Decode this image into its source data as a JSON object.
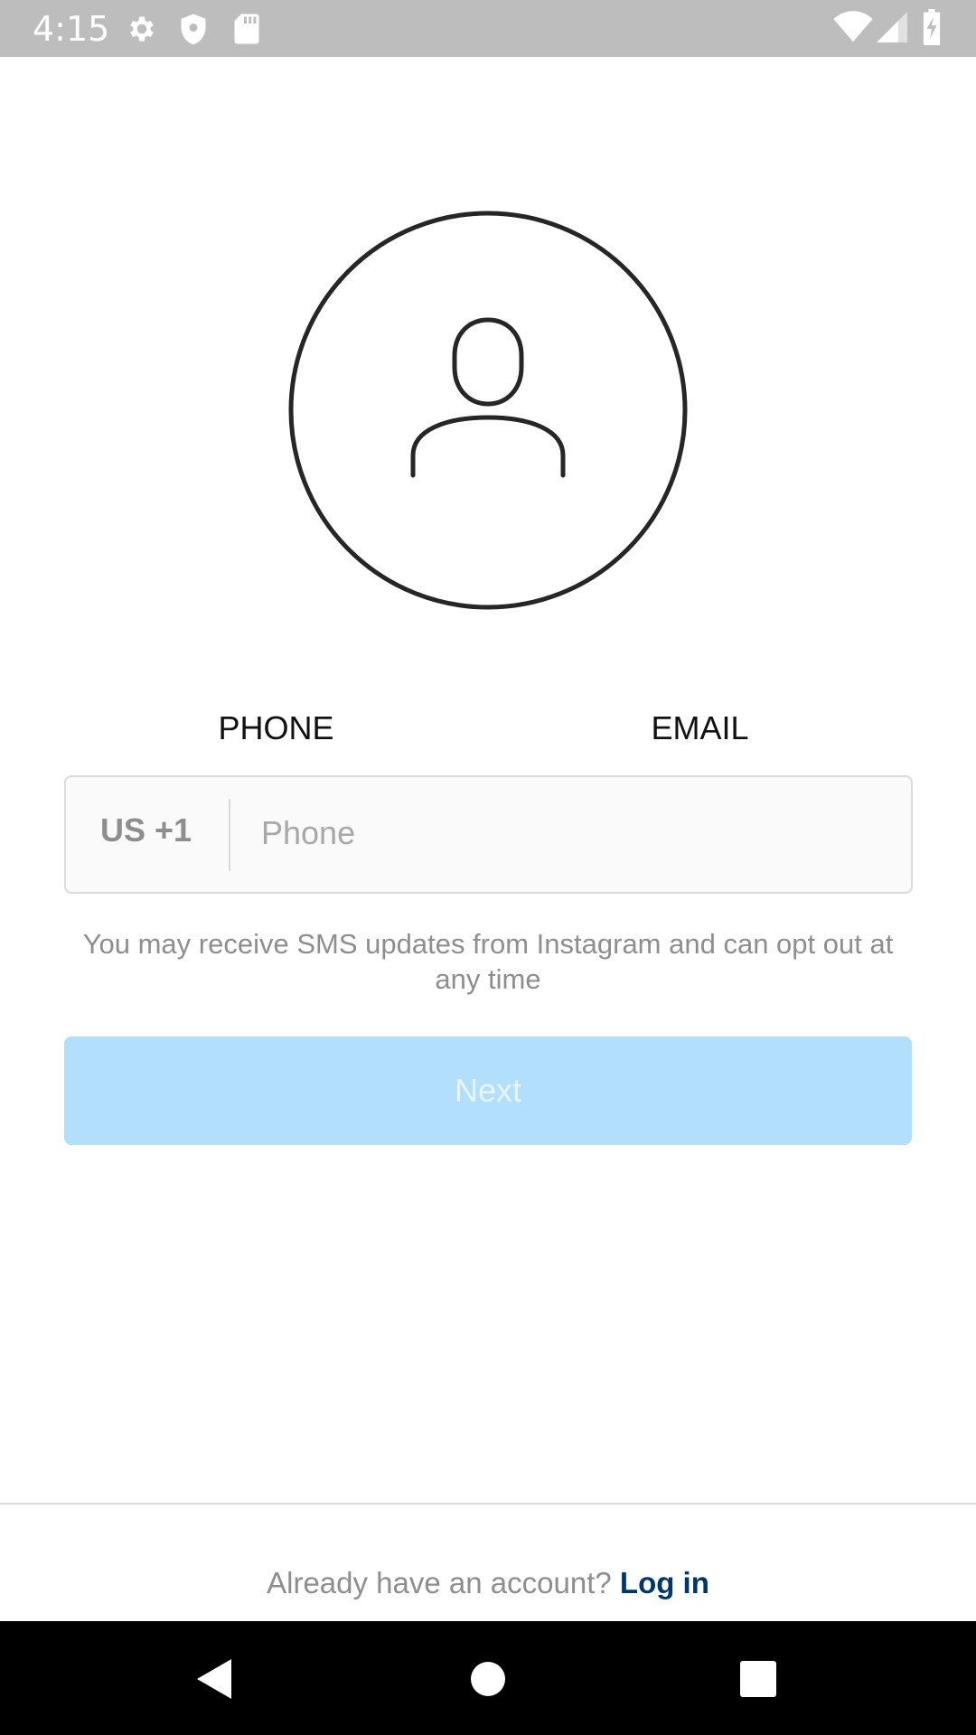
{
  "status_bar": {
    "time": "4:15",
    "icons": [
      "gear-icon",
      "shield-icon",
      "sd-card-icon",
      "wifi-icon",
      "signal-icon",
      "battery-charging-icon"
    ]
  },
  "avatar": {
    "icon": "person-icon"
  },
  "tabs": [
    {
      "label": "PHONE",
      "active": true
    },
    {
      "label": "EMAIL",
      "active": false
    }
  ],
  "phone_form": {
    "country_code": "US +1",
    "phone_value": "",
    "phone_placeholder": "Phone"
  },
  "sms_note": "You may receive SMS updates from Instagram and can opt out at any time",
  "next_button": {
    "label": "Next",
    "enabled": false
  },
  "footer": {
    "prompt": "Already have an account?",
    "login_label": "Log in"
  },
  "nav_bar": {
    "buttons": [
      "back-icon",
      "home-icon",
      "recents-icon"
    ]
  },
  "colors": {
    "status_bar_bg": "#bdbdbd",
    "button_disabled_bg": "#b2dffc",
    "link": "#00376b",
    "muted_text": "#8e8e8e",
    "border": "#dbdbdb"
  }
}
